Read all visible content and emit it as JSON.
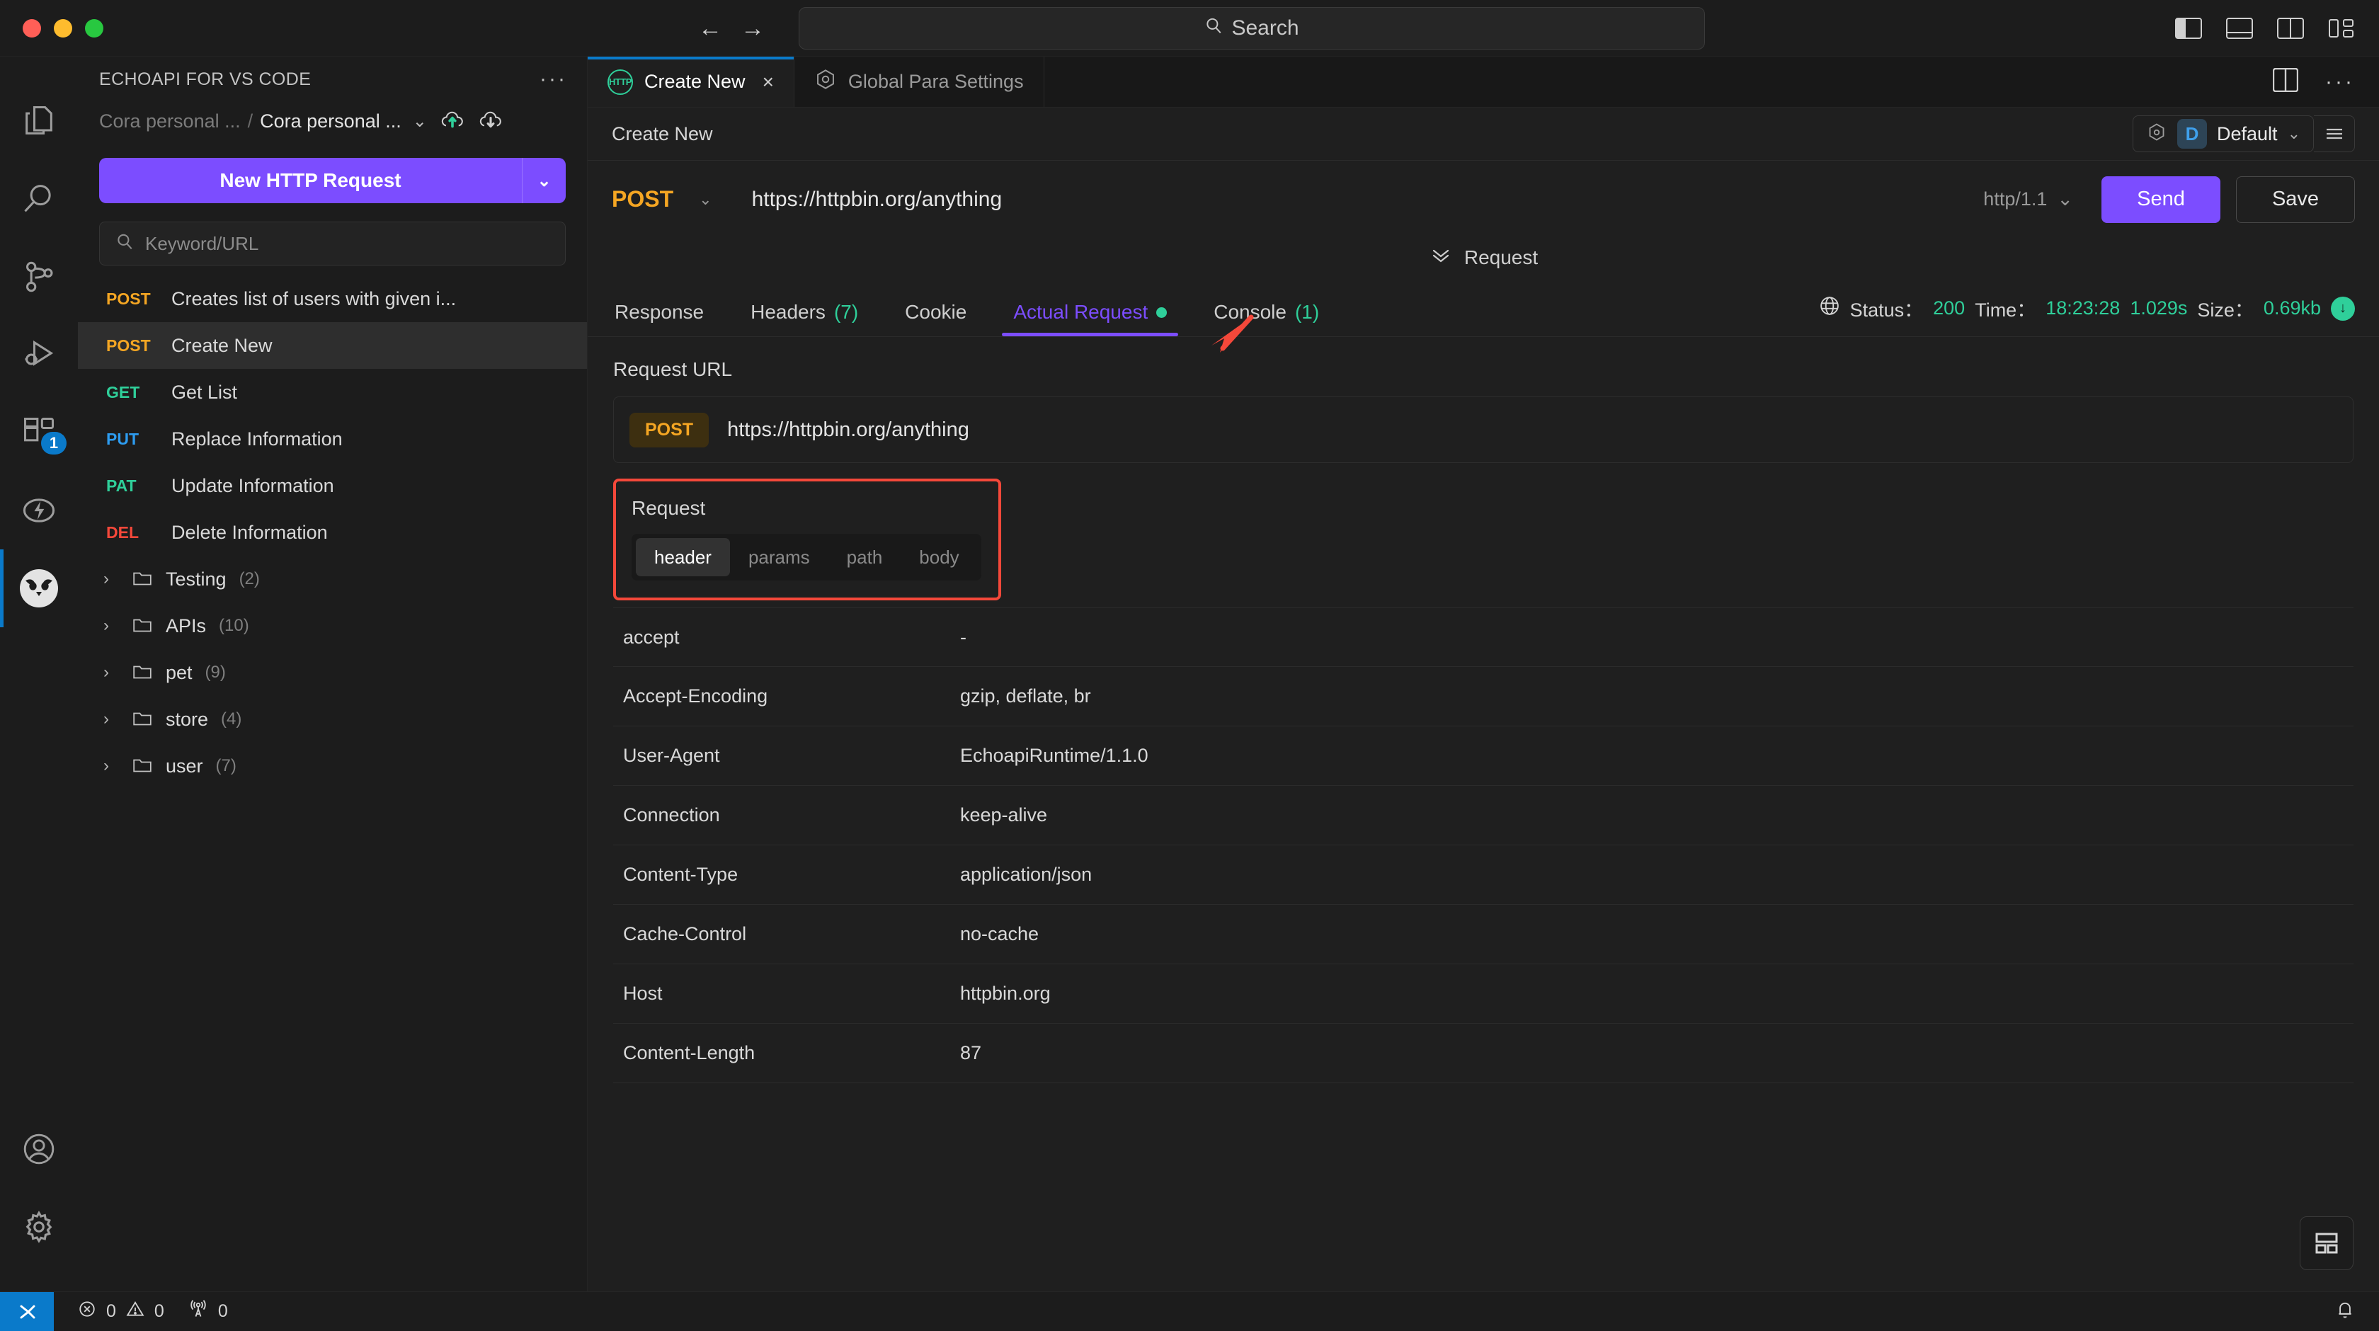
{
  "titlebar": {
    "back_icon": "arrow-left-icon",
    "forward_icon": "arrow-right-icon",
    "search_placeholder": "Search",
    "search_icon": "search-icon",
    "layout_icons": [
      "toggle-primary-sidebar-icon",
      "toggle-panel-icon",
      "toggle-secondary-sidebar-icon",
      "customize-layout-icon"
    ]
  },
  "activitybar": {
    "items": [
      {
        "name": "explorer-icon",
        "badge": ""
      },
      {
        "name": "search-icon",
        "badge": ""
      },
      {
        "name": "source-control-icon",
        "badge": ""
      },
      {
        "name": "run-and-debug-icon",
        "badge": ""
      },
      {
        "name": "extensions-icon",
        "badge": "1"
      },
      {
        "name": "lightning-icon",
        "badge": ""
      },
      {
        "name": "echoapi-owl-icon",
        "badge": ""
      }
    ],
    "bottom": [
      {
        "name": "accounts-icon"
      },
      {
        "name": "settings-gear-icon"
      }
    ]
  },
  "sidebar": {
    "title": "ECHOAPI FOR VS CODE",
    "more_label": "···",
    "breadcrumb": {
      "parent": "Cora personal ...",
      "separator": "/",
      "current": "Cora personal ...",
      "chevron": "⌄",
      "upload_icon": "cloud-upload-icon",
      "download_icon": "cloud-download-icon"
    },
    "new_request_button": "New HTTP Request",
    "new_request_dropdown": "⌄",
    "search_placeholder": "Keyword/URL",
    "requests": [
      {
        "method": "POST",
        "method_class": "m-post",
        "name": "Creates list of users with given i...",
        "selected": false
      },
      {
        "method": "POST",
        "method_class": "m-post",
        "name": "Create New",
        "selected": true
      },
      {
        "method": "GET",
        "method_class": "m-get",
        "name": "Get List",
        "selected": false
      },
      {
        "method": "PUT",
        "method_class": "m-put",
        "name": "Replace Information",
        "selected": false
      },
      {
        "method": "PAT",
        "method_class": "m-pat",
        "name": "Update Information",
        "selected": false
      },
      {
        "method": "DEL",
        "method_class": "m-del",
        "name": "Delete Information",
        "selected": false
      }
    ],
    "folders": [
      {
        "name": "Testing",
        "count": "(2)"
      },
      {
        "name": "APIs",
        "count": "(10)"
      },
      {
        "name": "pet",
        "count": "(9)"
      },
      {
        "name": "store",
        "count": "(4)"
      },
      {
        "name": "user",
        "count": "(7)"
      }
    ]
  },
  "tabs": [
    {
      "label": "Create New",
      "icon": "http-icon",
      "active": true,
      "closable": true,
      "close": "×"
    },
    {
      "label": "Global Para Settings",
      "icon": "global-settings-icon",
      "active": false,
      "closable": false,
      "close": ""
    }
  ],
  "tabbar_right": {
    "split_icon": "split-editor-icon",
    "more_icon": "more-actions-icon",
    "more_label": "···"
  },
  "panel": {
    "title": "Create New",
    "environment": {
      "settings_icon": "env-settings-icon",
      "badge": "D",
      "name": "Default",
      "chevron": "⌄",
      "menu_icon": "hamburger-menu-icon"
    },
    "url_row": {
      "method": "POST",
      "method_chevron": "⌄",
      "url": "https://httpbin.org/anything",
      "protocol": "http/1.1",
      "protocol_chevron": "⌄",
      "send_label": "Send",
      "save_label": "Save"
    },
    "collapse_label": "Request",
    "collapse_chevron": "»"
  },
  "response_tabs": [
    {
      "label": "Response",
      "count": "",
      "active": false,
      "dot": false
    },
    {
      "label": "Headers",
      "count": "(7)",
      "active": false,
      "dot": false
    },
    {
      "label": "Cookie",
      "count": "",
      "active": false,
      "dot": false
    },
    {
      "label": "Actual Request",
      "count": "",
      "active": true,
      "dot": true
    },
    {
      "label": "Console",
      "count": "(1)",
      "active": false,
      "dot": false
    }
  ],
  "status": {
    "globe_icon": "globe-icon",
    "status_label": "Status：",
    "status_value": "200",
    "time_label": "Time：",
    "time_value": "18:23:28",
    "duration_value": "1.029s",
    "size_label": "Size：",
    "size_value": "0.69kb",
    "download_icon": "download-circle-icon"
  },
  "content": {
    "request_url_label": "Request URL",
    "request_url_method": "POST",
    "request_url_value": "https://httpbin.org/anything",
    "request_box": {
      "title": "Request",
      "segments": [
        {
          "label": "header",
          "active": true
        },
        {
          "label": "params",
          "active": false
        },
        {
          "label": "path",
          "active": false
        },
        {
          "label": "body",
          "active": false
        }
      ]
    },
    "headers": [
      {
        "key": "accept",
        "value": "-"
      },
      {
        "key": "Accept-Encoding",
        "value": "gzip, deflate, br"
      },
      {
        "key": "User-Agent",
        "value": "EchoapiRuntime/1.1.0"
      },
      {
        "key": "Connection",
        "value": "keep-alive"
      },
      {
        "key": "Content-Type",
        "value": "application/json"
      },
      {
        "key": "Cache-Control",
        "value": "no-cache"
      },
      {
        "key": "Host",
        "value": "httpbin.org"
      },
      {
        "key": "Content-Length",
        "value": "87"
      }
    ],
    "corner_button_icon": "layout-grid-icon"
  },
  "statusbar": {
    "remote_icon": "remote-window-icon",
    "errors_icon": "error-icon",
    "errors": "0",
    "warnings_icon": "warning-icon",
    "warnings": "0",
    "ports_icon": "radio-tower-icon",
    "ports": "0",
    "bell_icon": "bell-icon"
  },
  "colors": {
    "accent_purple": "#7c4dff",
    "method_post": "#f5a623",
    "method_get": "#2fcf9a",
    "method_put": "#2d9cf0",
    "method_del": "#f4483a",
    "success_green": "#2fcf9a",
    "annotation_red": "#f4483a",
    "vscode_blue": "#0a7aca"
  }
}
